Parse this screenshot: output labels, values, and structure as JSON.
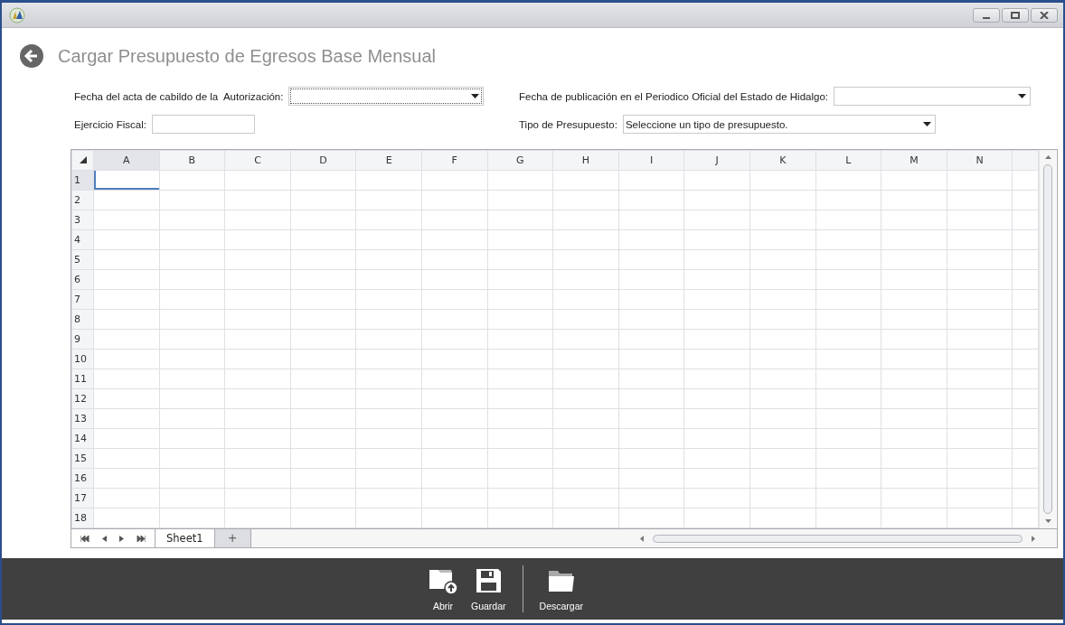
{
  "header": {
    "title": "Cargar Presupuesto de Egresos Base Mensual"
  },
  "form": {
    "fecha_acta": {
      "label": "Fecha del acta de cabildo de la  Autorización:",
      "focused": true
    },
    "fecha_publicacion": {
      "label": "Fecha de publicación en el Periodico Oficial del Estado de Hidalgo:"
    },
    "ejercicio_fiscal": {
      "label": "Ejercicio Fiscal:"
    },
    "tipo_presupuesto": {
      "label": "Tipo de Presupuesto:",
      "value": "Seleccione un tipo de presupuesto."
    }
  },
  "spreadsheet": {
    "columns": [
      {
        "label": "A",
        "selected": true
      },
      {
        "label": "B",
        "selected": false
      },
      {
        "label": "C",
        "selected": false
      },
      {
        "label": "D",
        "selected": false
      },
      {
        "label": "E",
        "selected": false
      },
      {
        "label": "F",
        "selected": false
      },
      {
        "label": "G",
        "selected": false
      },
      {
        "label": "H",
        "selected": false
      },
      {
        "label": "I",
        "selected": false
      },
      {
        "label": "J",
        "selected": false
      },
      {
        "label": "K",
        "selected": false
      },
      {
        "label": "L",
        "selected": false
      },
      {
        "label": "M",
        "selected": false
      },
      {
        "label": "N",
        "selected": false
      }
    ],
    "rows": [
      {
        "label": "1",
        "selected": true
      },
      {
        "label": "2",
        "selected": false
      },
      {
        "label": "3",
        "selected": false
      },
      {
        "label": "4",
        "selected": false
      },
      {
        "label": "5",
        "selected": false
      },
      {
        "label": "6",
        "selected": false
      },
      {
        "label": "7",
        "selected": false
      },
      {
        "label": "8",
        "selected": false
      },
      {
        "label": "9",
        "selected": false
      },
      {
        "label": "10",
        "selected": false
      },
      {
        "label": "11",
        "selected": false
      },
      {
        "label": "12",
        "selected": false
      },
      {
        "label": "13",
        "selected": false
      },
      {
        "label": "14",
        "selected": false
      },
      {
        "label": "15",
        "selected": false
      },
      {
        "label": "16",
        "selected": false
      },
      {
        "label": "17",
        "selected": false
      },
      {
        "label": "18",
        "selected": false
      }
    ],
    "sheets": [
      {
        "label": "Sheet1",
        "selected": true
      }
    ],
    "add_sheet": "+"
  },
  "toolbar": {
    "buttons": [
      {
        "kind": "open",
        "label": "Abrir"
      },
      {
        "kind": "save",
        "label": "Guardar"
      },
      {
        "kind": "separator"
      },
      {
        "kind": "download",
        "label": "Descargar"
      }
    ]
  }
}
